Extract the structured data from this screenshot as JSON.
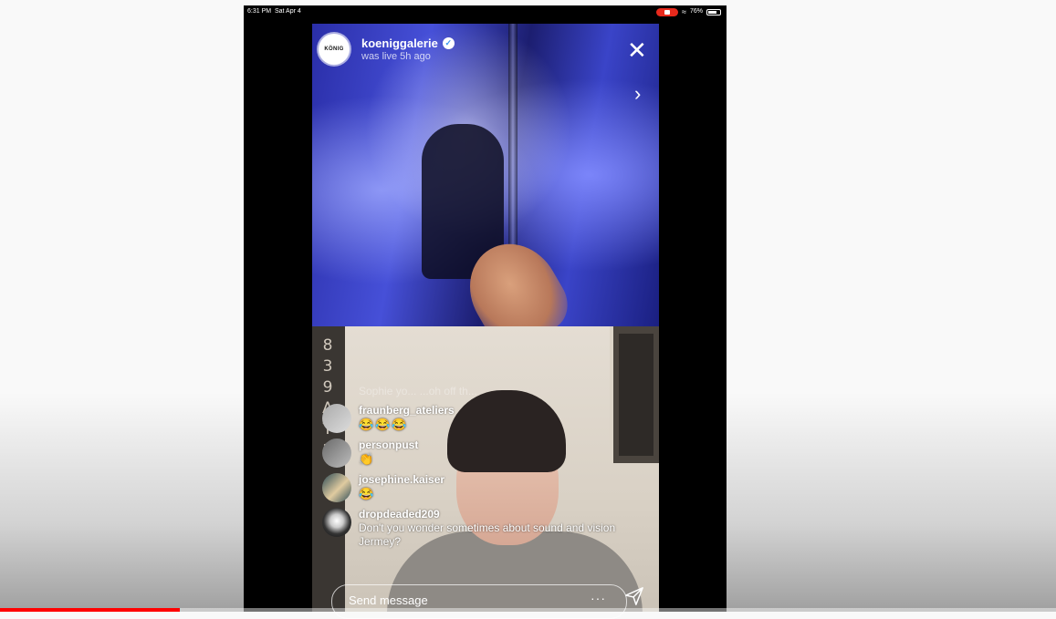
{
  "statusbar": {
    "time": "6:31 PM",
    "date": "Sat Apr 4",
    "battery_percent": "76%",
    "battery_level": 0.76
  },
  "profile": {
    "avatar_text": "KÖNIG",
    "username": "koeniggalerie",
    "status": "was live 5h ago"
  },
  "edge_text": "8 3 9 A T 2",
  "faded_comment": "Sophie yo... ...oh off th...",
  "comments": [
    {
      "user": "fraunberg_ateliers",
      "text": "😂😂😂"
    },
    {
      "user": "personpust",
      "text": "👏"
    },
    {
      "user": "josephine.kaiser",
      "text": "😂"
    },
    {
      "user": "dropdeaded209",
      "text": "Don't you wonder sometimes about sound and vision Jermey?"
    }
  ],
  "composer": {
    "placeholder": "Send message",
    "more": "···"
  },
  "video_progress": 0.17,
  "colors": {
    "progress": "#ff0000",
    "verified": "#3897f0",
    "rec": "#e8291c"
  }
}
